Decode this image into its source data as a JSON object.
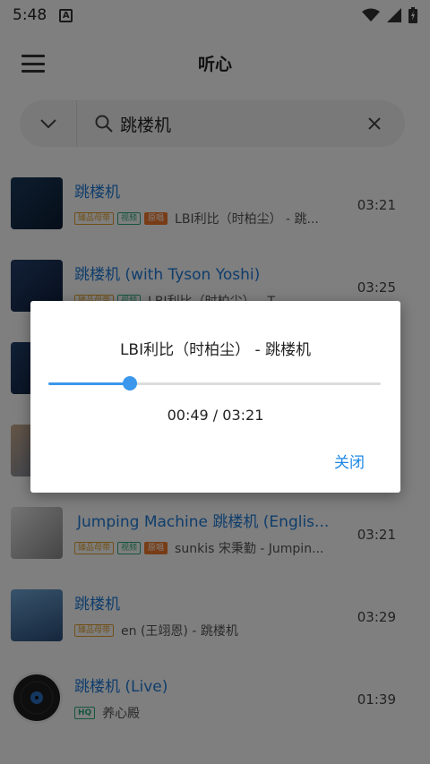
{
  "status_bar": {
    "time": "5:48",
    "notification_icon": "a-badge-icon",
    "icons": [
      "wifi-icon",
      "signal-icon",
      "battery-icon"
    ]
  },
  "app_bar": {
    "title": "听心",
    "menu_icon": "hamburger-menu-icon"
  },
  "search": {
    "query": "跳楼机",
    "dropdown_icon": "chevron-down-icon",
    "search_icon": "search-icon",
    "clear_icon": "close-icon"
  },
  "songs": [
    {
      "title": "跳楼机",
      "tags": [
        "臻品母带",
        "视频",
        "原唱"
      ],
      "artist": "LBI利比（时柏尘） - 跳...",
      "duration": "03:21"
    },
    {
      "title": "跳楼机 (with Tyson Yoshi)",
      "tags": [
        "臻品母带",
        "视频"
      ],
      "artist": "LBI利比（时柏尘） - T...",
      "duration": "03:25"
    },
    {
      "title": "",
      "tags": [],
      "artist": "",
      "duration": ""
    },
    {
      "title": "",
      "tags": [],
      "artist": "",
      "duration": ""
    },
    {
      "title": "Jumping Machine 跳楼机 (Englis...",
      "tags": [
        "臻品母带",
        "视频",
        "原唱"
      ],
      "artist": "sunkis 宋秉勤 - Jumpin...",
      "duration": "03:21"
    },
    {
      "title": "跳楼机",
      "tags": [
        "臻品母带"
      ],
      "artist": "en (王翊恩) - 跳楼机",
      "duration": "03:29"
    },
    {
      "title": "跳楼机 (Live)",
      "tags": [
        "HQ"
      ],
      "artist": "养心殿",
      "duration": "01:39"
    }
  ],
  "dialog": {
    "title": "LBI利比（时柏尘） - 跳楼机",
    "progress_fraction": 0.245,
    "time": "00:49 / 03:21",
    "close_label": "关闭"
  },
  "colors": {
    "accent": "#3a97ec",
    "title_blue": "#1e7ad8",
    "overlay": "rgba(0,0,0,0.5)"
  }
}
